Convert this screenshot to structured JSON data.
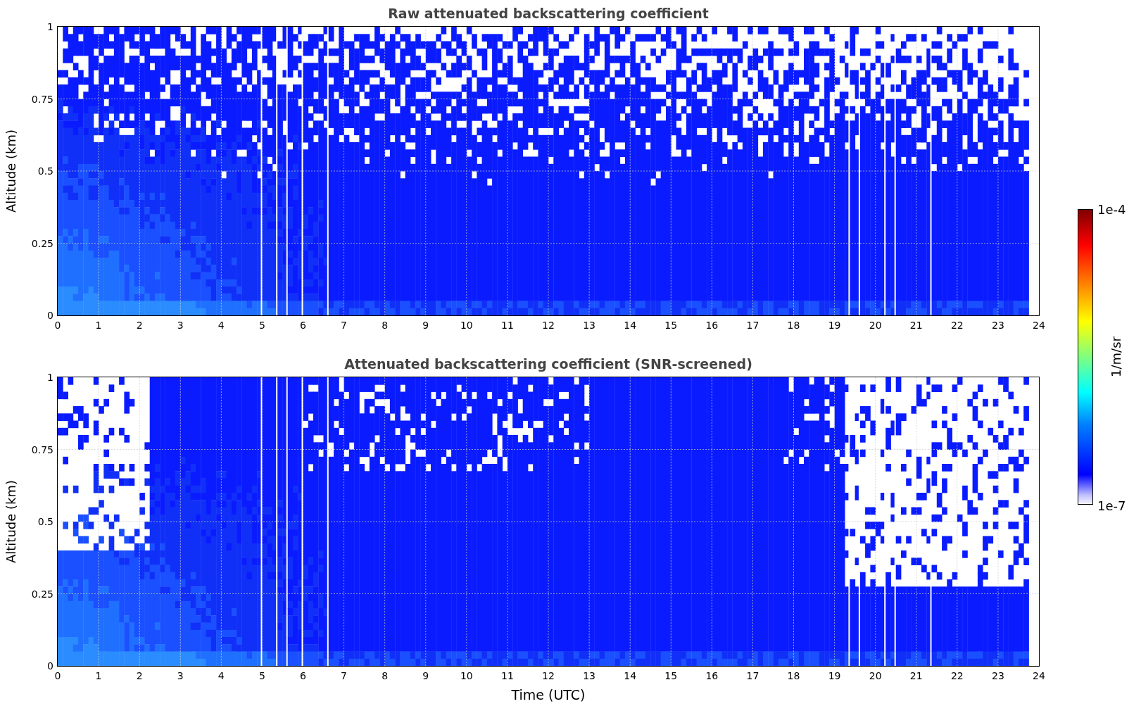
{
  "panels": [
    {
      "title": "Raw attenuated backscattering coefficient",
      "ylabel": "Altitude (km)",
      "yticks": [
        "1",
        "0.75",
        "0.5",
        "0.25",
        "0"
      ],
      "xticks": [
        "0",
        "1",
        "2",
        "3",
        "4",
        "5",
        "6",
        "7",
        "8",
        "9",
        "10",
        "11",
        "12",
        "13",
        "14",
        "15",
        "16",
        "17",
        "18",
        "19",
        "20",
        "21",
        "22",
        "23",
        "24"
      ],
      "kind": "raw"
    },
    {
      "title": "Attenuated backscattering coefficient (SNR-screened)",
      "ylabel": "Altitude (km)",
      "yticks": [
        "1",
        "0.75",
        "0.5",
        "0.25",
        "0"
      ],
      "xticks": [
        "0",
        "1",
        "2",
        "3",
        "4",
        "5",
        "6",
        "7",
        "8",
        "9",
        "10",
        "11",
        "12",
        "13",
        "14",
        "15",
        "16",
        "17",
        "18",
        "19",
        "20",
        "21",
        "22",
        "23",
        "24"
      ],
      "kind": "screened",
      "xlabel": "Time (UTC)"
    }
  ],
  "colorbar": {
    "max_label": "1e-4",
    "min_label": "1e-7",
    "label": "1/m/sr"
  }
}
